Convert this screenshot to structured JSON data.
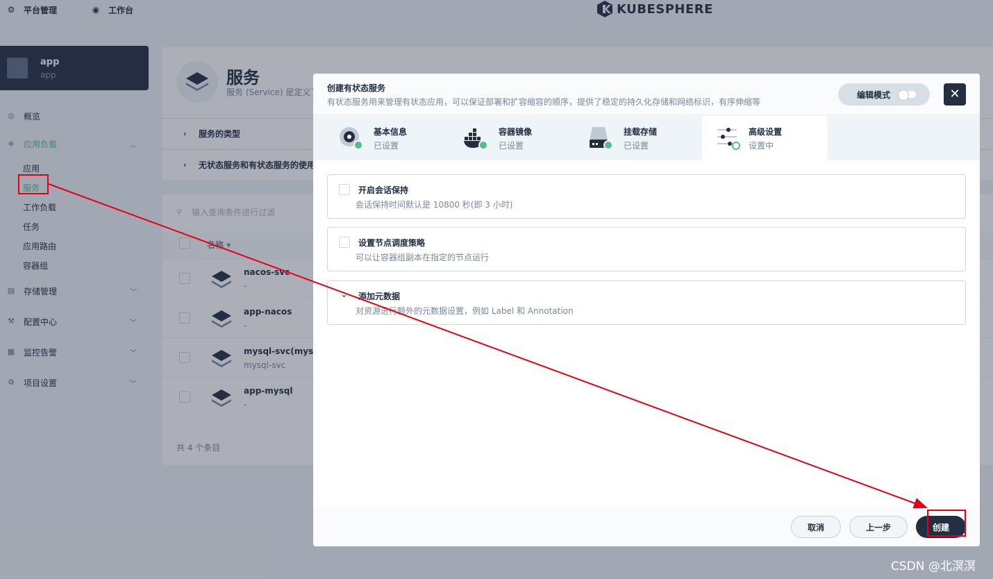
{
  "topbar": {
    "platform_label": "平台管理",
    "workbench_label": "工作台",
    "logo_text": "KUBESPHERE"
  },
  "project": {
    "name": "app",
    "sub": "app"
  },
  "sidebar": {
    "items": [
      {
        "label": "概览",
        "icon": "dashboard-icon"
      },
      {
        "label": "应用负载",
        "icon": "appstore-icon",
        "expanded": true
      },
      {
        "label": "存储管理",
        "icon": "storage-icon"
      },
      {
        "label": "配置中心",
        "icon": "hammer-icon"
      },
      {
        "label": "监控告警",
        "icon": "monitor-icon"
      },
      {
        "label": "项目设置",
        "icon": "gear-icon"
      }
    ],
    "sub_items": [
      "应用",
      "服务",
      "工作负载",
      "任务",
      "应用路由",
      "容器组"
    ],
    "active_sub": "服务"
  },
  "main": {
    "title": "服务",
    "desc": "服务 (Service) 是定义了",
    "accordions": [
      "服务的类型",
      "无状态服务和有状态服务的使用"
    ],
    "search_placeholder": "输入查询条件进行过滤",
    "col_name": "名称",
    "rows": [
      {
        "name": "nacos-svc",
        "sub": "-"
      },
      {
        "name": "app-nacos",
        "sub": "-"
      },
      {
        "name": "mysql-svc(mysql-s",
        "sub": "mysql-svc"
      },
      {
        "name": "app-mysql",
        "sub": "-"
      }
    ],
    "total": "共 4 个条目"
  },
  "modal": {
    "title": "创建有状态服务",
    "desc": "有状态服务用来管理有状态应用，可以保证部署和扩容缩容的顺序，提供了稳定的持久化存储和网络标识，有序伸缩等",
    "edit_mode": "编辑模式",
    "steps": [
      {
        "name": "基本信息",
        "status": "已设置"
      },
      {
        "name": "容器镜像",
        "status": "已设置"
      },
      {
        "name": "挂载存储",
        "status": "已设置"
      },
      {
        "name": "高级设置",
        "status": "设置中"
      }
    ],
    "options": [
      {
        "title": "开启会话保持",
        "desc": "会话保持时间默认是 10800 秒(即 3 小时)"
      },
      {
        "title": "设置节点调度策略",
        "desc": "可以让容器组副本在指定的节点运行"
      },
      {
        "title": "添加元数据",
        "desc": "对资源进行额外的元数据设置，例如 Label 和 Annotation"
      }
    ],
    "buttons": {
      "cancel": "取消",
      "prev": "上一步",
      "create": "创建"
    }
  },
  "watermark": "CSDN @北溟溟",
  "colors": {
    "accent": "#55bc8a",
    "dark": "#242e42",
    "annotation": "#e60012"
  }
}
